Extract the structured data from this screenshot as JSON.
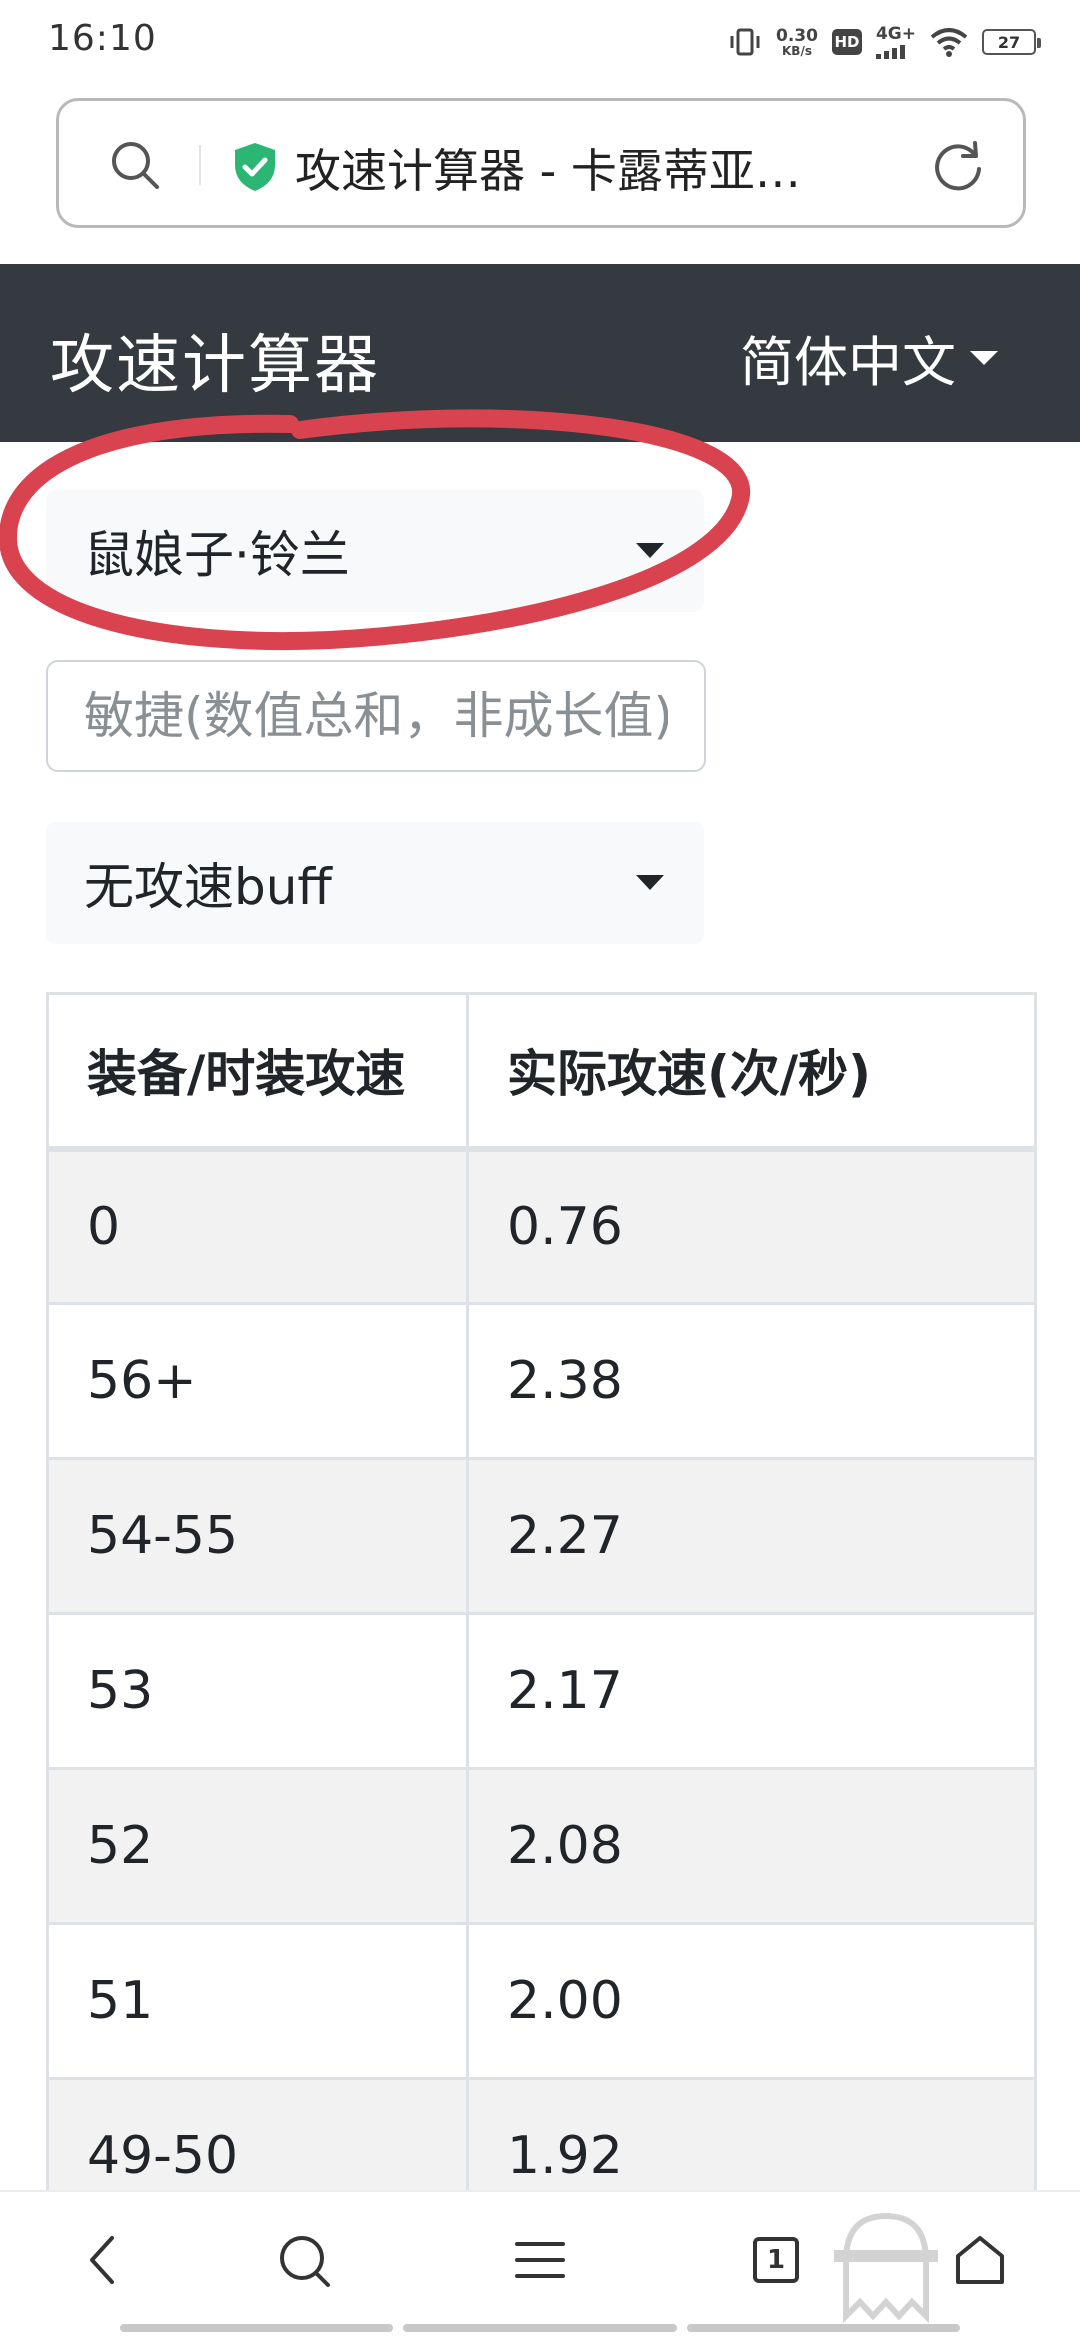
{
  "status_bar": {
    "time": "16:10",
    "net_speed_value": "0.30",
    "net_speed_unit": "KB/s",
    "hd_label": "HD",
    "network_type": "4G+",
    "battery": "27"
  },
  "address_bar": {
    "page_title": "攻速计算器 - 卡露蒂亚…",
    "secure_color": "#2bb673"
  },
  "navbar": {
    "brand": "攻速计算器",
    "language": "简体中文",
    "background": "#343a40"
  },
  "form": {
    "character_select": {
      "selected": "鼠娘子·铃兰"
    },
    "agility_input": {
      "value": "",
      "placeholder": "敏捷(数值总和，非成长值)"
    },
    "buff_select": {
      "selected": "无攻速buff"
    }
  },
  "annotation": {
    "color": "#d9434f"
  },
  "table": {
    "headers": [
      "装备/时装攻速",
      "实际攻速(次/秒)"
    ],
    "rows": [
      [
        "0",
        "0.76"
      ],
      [
        "56+",
        "2.38"
      ],
      [
        "54-55",
        "2.27"
      ],
      [
        "53",
        "2.17"
      ],
      [
        "52",
        "2.08"
      ],
      [
        "51",
        "2.00"
      ],
      [
        "49-50",
        "1.92"
      ]
    ]
  },
  "bottom_bar": {
    "tab_count": "1",
    "icons": [
      "back-icon",
      "search-icon",
      "menu-icon",
      "tabs-icon",
      "home-icon"
    ]
  }
}
